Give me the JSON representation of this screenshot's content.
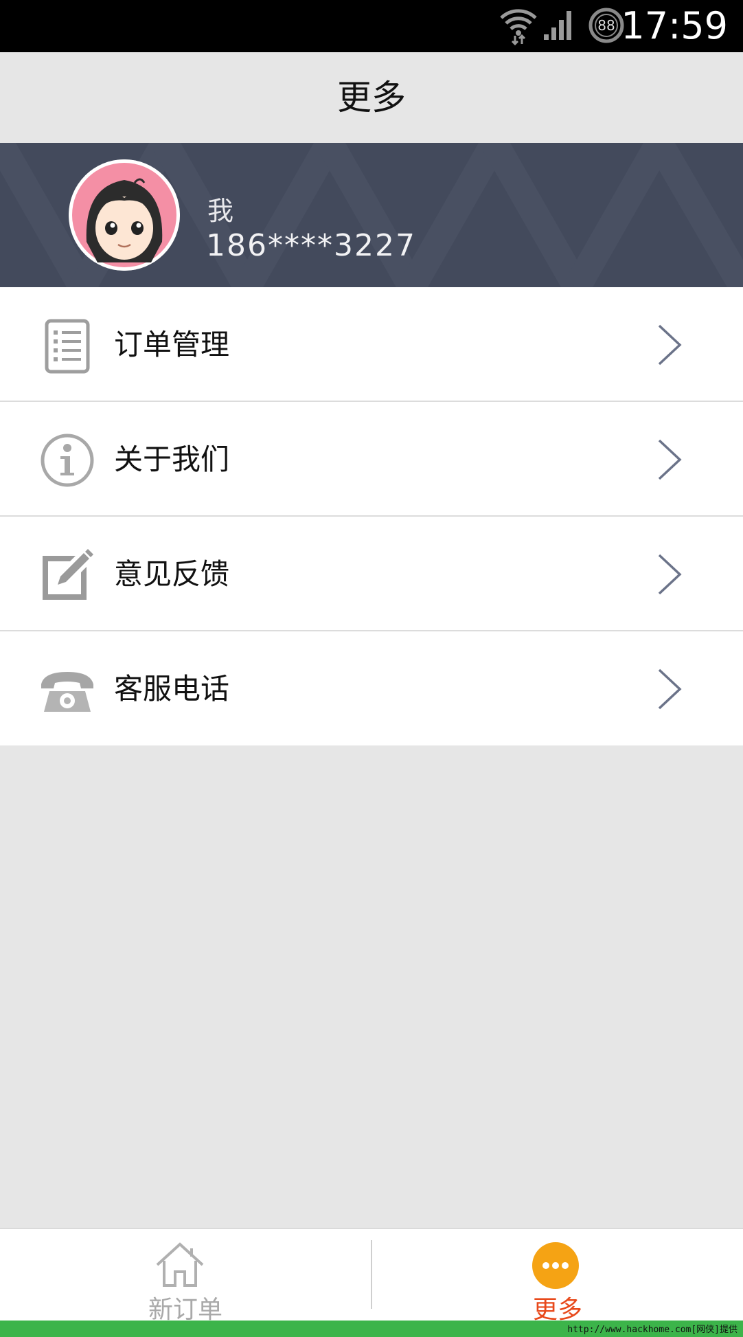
{
  "status_bar": {
    "time": "17:59",
    "battery_level": "88",
    "icons": [
      "wifi-icon",
      "signal-icon",
      "battery-icon"
    ]
  },
  "header": {
    "title": "更多"
  },
  "profile": {
    "name": "我",
    "phone": "186****3227",
    "avatar_icon": "girl-avatar-icon"
  },
  "menu": {
    "items": [
      {
        "label": "订单管理",
        "icon": "document-list-icon"
      },
      {
        "label": "关于我们",
        "icon": "info-icon"
      },
      {
        "label": "意见反馈",
        "icon": "edit-icon"
      },
      {
        "label": "客服电话",
        "icon": "telephone-icon"
      }
    ]
  },
  "bottom_nav": {
    "items": [
      {
        "label": "新订单",
        "icon": "home-icon",
        "active": false
      },
      {
        "label": "更多",
        "icon": "more-icon",
        "active": true
      }
    ],
    "active_color": "#e8491b",
    "inactive_color": "#a9a9a9"
  },
  "watermark": {
    "text": "http://www.hackhome.com[网侠]提供"
  },
  "colors": {
    "banner": "#434a5c",
    "accent_orange": "#f5a314",
    "background": "#e6e6e6"
  }
}
